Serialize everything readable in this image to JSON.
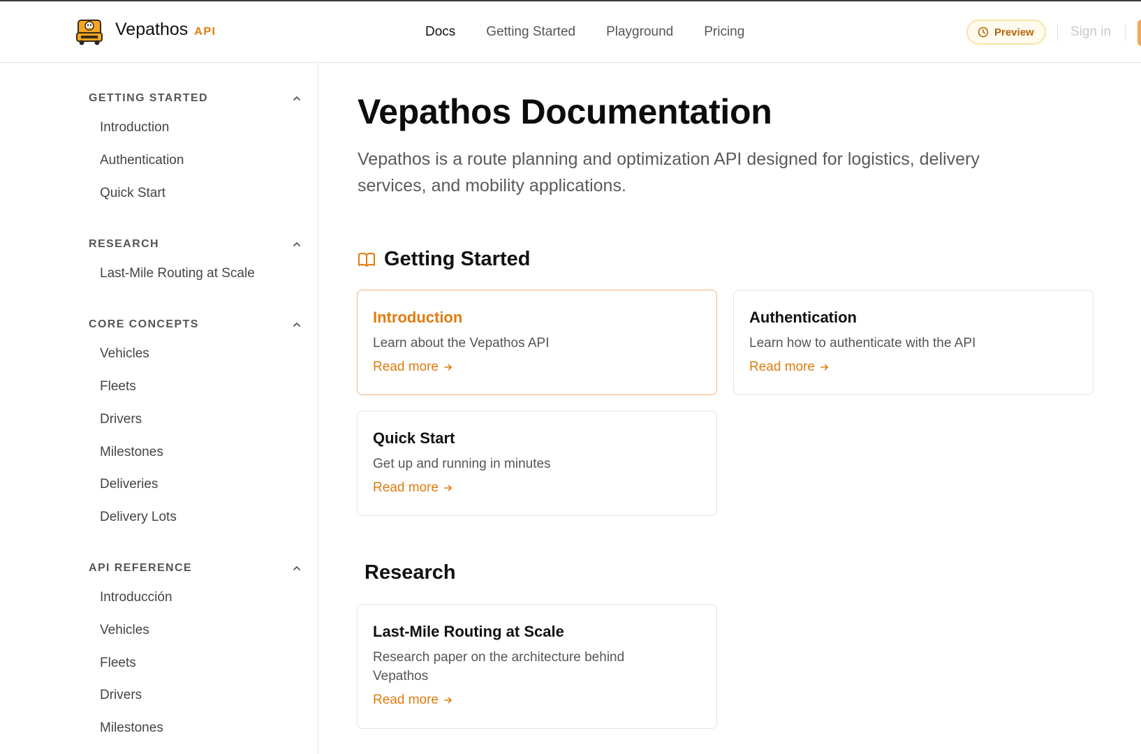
{
  "header": {
    "brand_name": "Vepathos",
    "brand_tag": "API",
    "nav": [
      {
        "label": "Docs",
        "active": true
      },
      {
        "label": "Getting Started",
        "active": false
      },
      {
        "label": "Playground",
        "active": false
      },
      {
        "label": "Pricing",
        "active": false
      }
    ],
    "preview_label": "Preview",
    "signin_label": "Sign in"
  },
  "sidebar": {
    "sections": [
      {
        "title": "GETTING STARTED",
        "items": [
          "Introduction",
          "Authentication",
          "Quick Start"
        ]
      },
      {
        "title": "RESEARCH",
        "items": [
          "Last-Mile Routing at Scale"
        ]
      },
      {
        "title": "CORE CONCEPTS",
        "items": [
          "Vehicles",
          "Fleets",
          "Drivers",
          "Milestones",
          "Deliveries",
          "Delivery Lots"
        ]
      },
      {
        "title": "API REFERENCE",
        "items": [
          "Introducción",
          "Vehicles",
          "Fleets",
          "Drivers",
          "Milestones"
        ]
      }
    ]
  },
  "main": {
    "title": "Vepathos Documentation",
    "subtitle": "Vepathos is a route planning and optimization API designed for logistics, delivery services, and mobility applications.",
    "sections": [
      {
        "title": "Getting Started",
        "icon": "book-open-icon",
        "cards": [
          {
            "title": "Introduction",
            "desc": "Learn about the Vepathos API",
            "link": "Read more",
            "highlight": true
          },
          {
            "title": "Authentication",
            "desc": "Learn how to authenticate with the API",
            "link": "Read more",
            "highlight": false
          },
          {
            "title": "Quick Start",
            "desc": "Get up and running in minutes",
            "link": "Read more",
            "highlight": false
          }
        ]
      },
      {
        "title": "Research",
        "cards": [
          {
            "title": "Last-Mile Routing at Scale",
            "desc": "Research paper on the architecture behind Vepathos",
            "link": "Read more",
            "highlight": false
          }
        ]
      }
    ]
  },
  "colors": {
    "accent": "#e07b0d",
    "preview_border": "#f7e3a6",
    "card_highlight_border": "#f2b27a"
  }
}
